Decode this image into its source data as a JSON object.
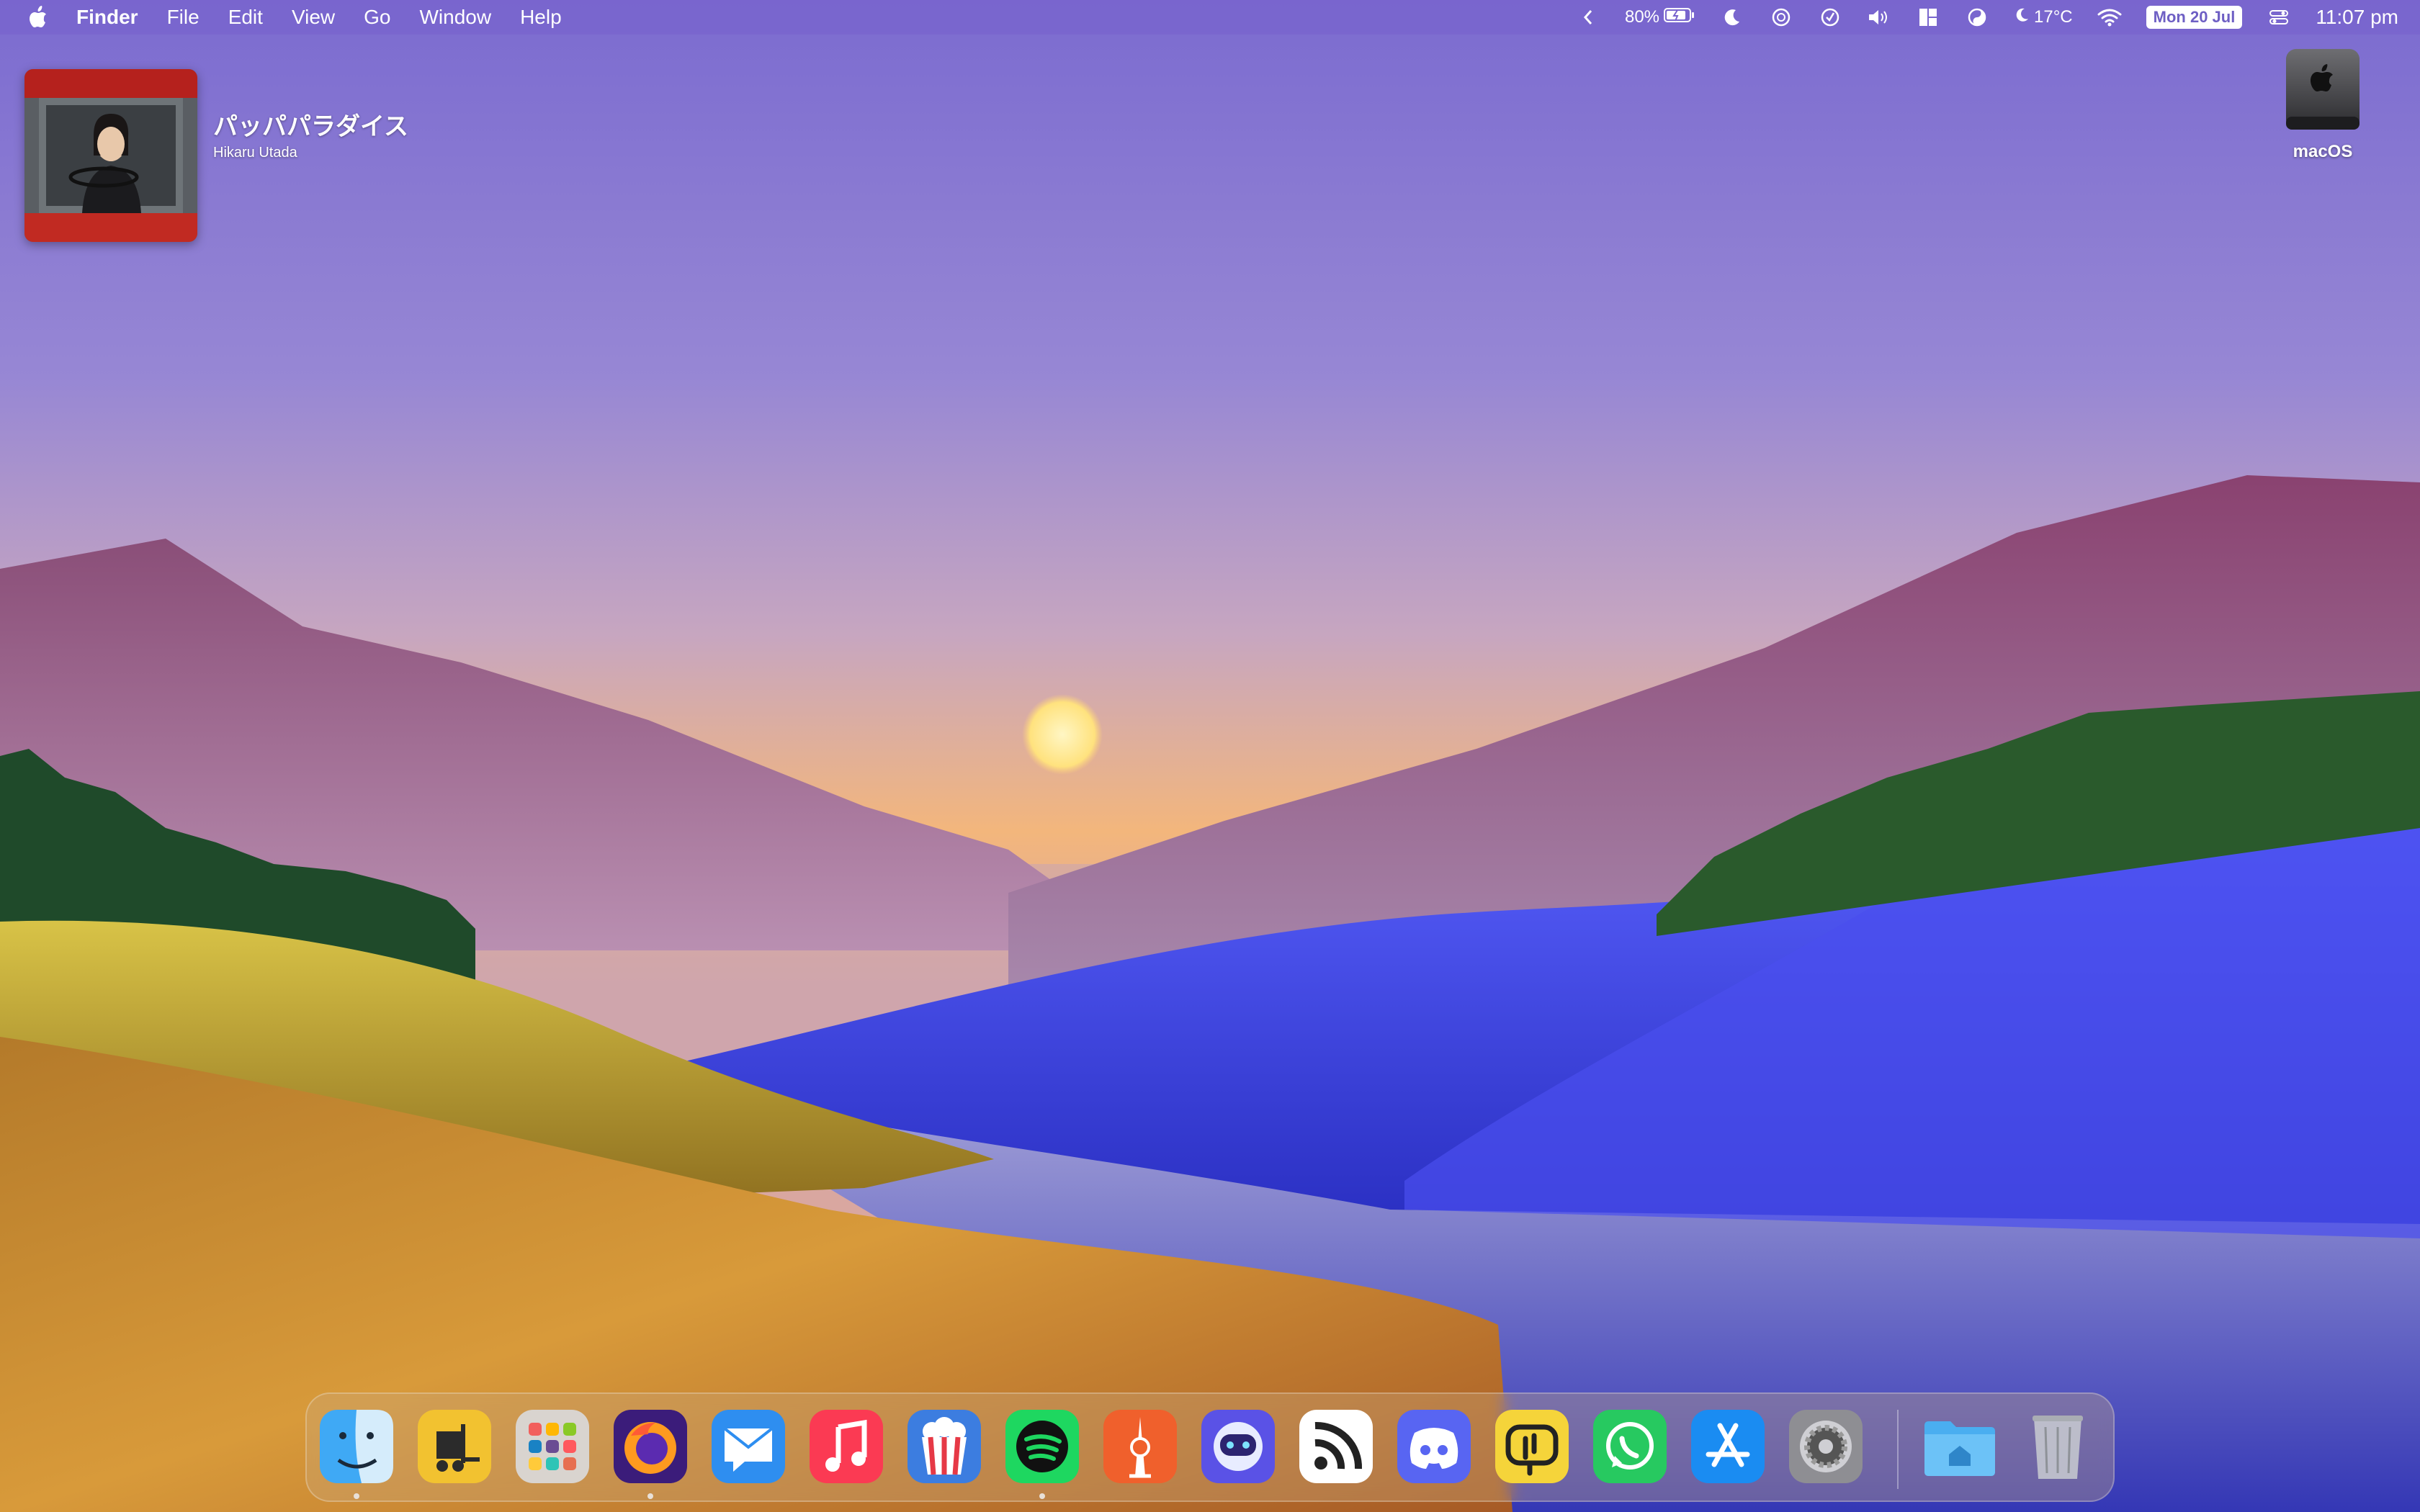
{
  "menubar": {
    "app_name": "Finder",
    "menus": [
      "File",
      "Edit",
      "View",
      "Go",
      "Window",
      "Help"
    ],
    "battery": "80%",
    "weather": "17°C",
    "date": "Mon 20 Jul",
    "time": "11:07 pm"
  },
  "now_playing": {
    "title": "パッパパラダイス",
    "artist": "Hikaru Utada"
  },
  "desktop": {
    "drive_label": "macOS"
  },
  "dock": {
    "apps": [
      "Finder",
      "Forklift",
      "Launchpad",
      "Firefox",
      "Mimestream",
      "Music",
      "Popcorn Time",
      "Spotify",
      "Tokyo",
      "Mastonaut",
      "NetNewsWire",
      "Discord",
      "Paste",
      "WhatsApp",
      "App Store",
      "System Preferences"
    ],
    "running": [
      "Finder",
      "Firefox",
      "Spotify"
    ]
  },
  "colors": {
    "sky_top": "#7d6fcf",
    "sky_horizon": "#f2b47a",
    "menubar": "#7864cd",
    "accent_blue": "#3d3fd8"
  }
}
